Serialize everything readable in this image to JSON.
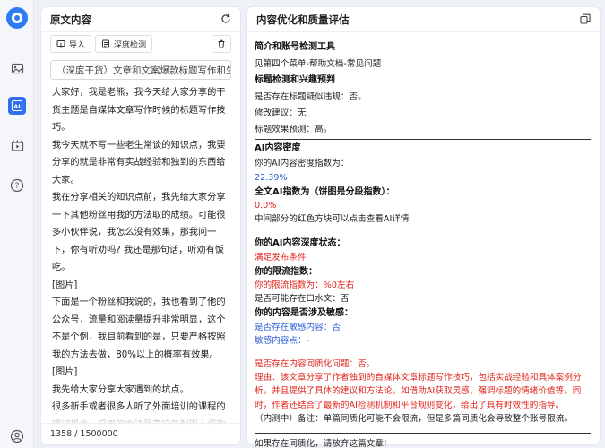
{
  "left_panel": {
    "title": "原文内容",
    "import_label": "导入",
    "detect_label": "深度检测",
    "title_input_value": "（深度干货）文章和文案爆款标题写作和生",
    "paragraphs": [
      "大家好，我是老熊，我今天给大家分享的干货主题是自媒体文章写作时候的标题写作技巧。",
      "我今天就不写一些老生常谈的知识点，我要分享的就是非常有实战经验和独到的东西给大家。",
      "我在分享相关的知识点前，我先给大家分享一下其他粉丝用我的方法取的成绩。可能很多小伙伴说，我怎么没有效果，那我问一下，你有听劝吗? 我还是那句话，听劝有饭吃。",
      "[图片]",
      "下面是一个粉丝和我说的，我也看到了他的公众号，流量和阅读量提升非常明显，这个不是个例，我目前看到的是，只要严格按照我的方法去做，80%以上的概率有效果。",
      "[图片]",
      "我先给大家分享大家遇到的坑点。",
      "很多新手或者很多人听了外面培训的课程的错误操作，采用的方法是直接复制别人爆款文章的标题，我想告诉你的是，这种方法是错误的，很容易度号"
    ],
    "counter": "1358 / 1500000"
  },
  "right_panel": {
    "title": "内容优化和质量评估",
    "lines": [
      {
        "text": "简介和账号检测工具",
        "style": "h"
      },
      {
        "text": "见第四个菜单-帮助文档-常见问题",
        "style": "t"
      },
      {
        "text": "标题检测和兴趣预判",
        "style": "h"
      },
      {
        "text": "是否存在标题疑似违规：否。",
        "style": "t"
      },
      {
        "text": "修改建议：无",
        "style": "t"
      },
      {
        "text": "标题效果预测：高。",
        "style": "t"
      }
    ],
    "ai_density_title": "AI内容密度",
    "ai_density_label": "你的AI内容密度指数为：",
    "ai_density_value": "22.39%",
    "full_ai_title": "全文AI指数为（饼图是分段指数）：",
    "full_ai_value": "0.0%",
    "full_ai_note": "中间部分的红色方块可以点击查看AI详情",
    "state_title": "你的AI内容深度状态：",
    "state_value": "满足发布条件",
    "limit_title": "你的限流指数：",
    "limit_value": "你的限流指数为：%0左右",
    "limit_note": "是否可能存在口水文：否",
    "sensitive_title": "你的内容是否涉及敏感：",
    "sensitive_line1": "是否存在敏感内容：否",
    "sensitive_line2": "敏感内容点：-",
    "homog_line": "是否存在内容同质化问题：否。",
    "reason_text": "理由：该文章分享了作者独到的自媒体文章标题写作技巧，包括实战经验和具体案例分析，并且提供了具体的建议和方法论，如借助AI获取灵感、强调标题的情绪价值等。同时，作者还结合了最新的AI检测机制和平台规则变化，给出了具有时效性的指导。",
    "note_text": "（内测中）备注：单篇同质化可能不会限流，但是多篇同质化会导致整个账号限流。",
    "footer_text": "如果存在同质化，请放弃这篇文章!"
  }
}
